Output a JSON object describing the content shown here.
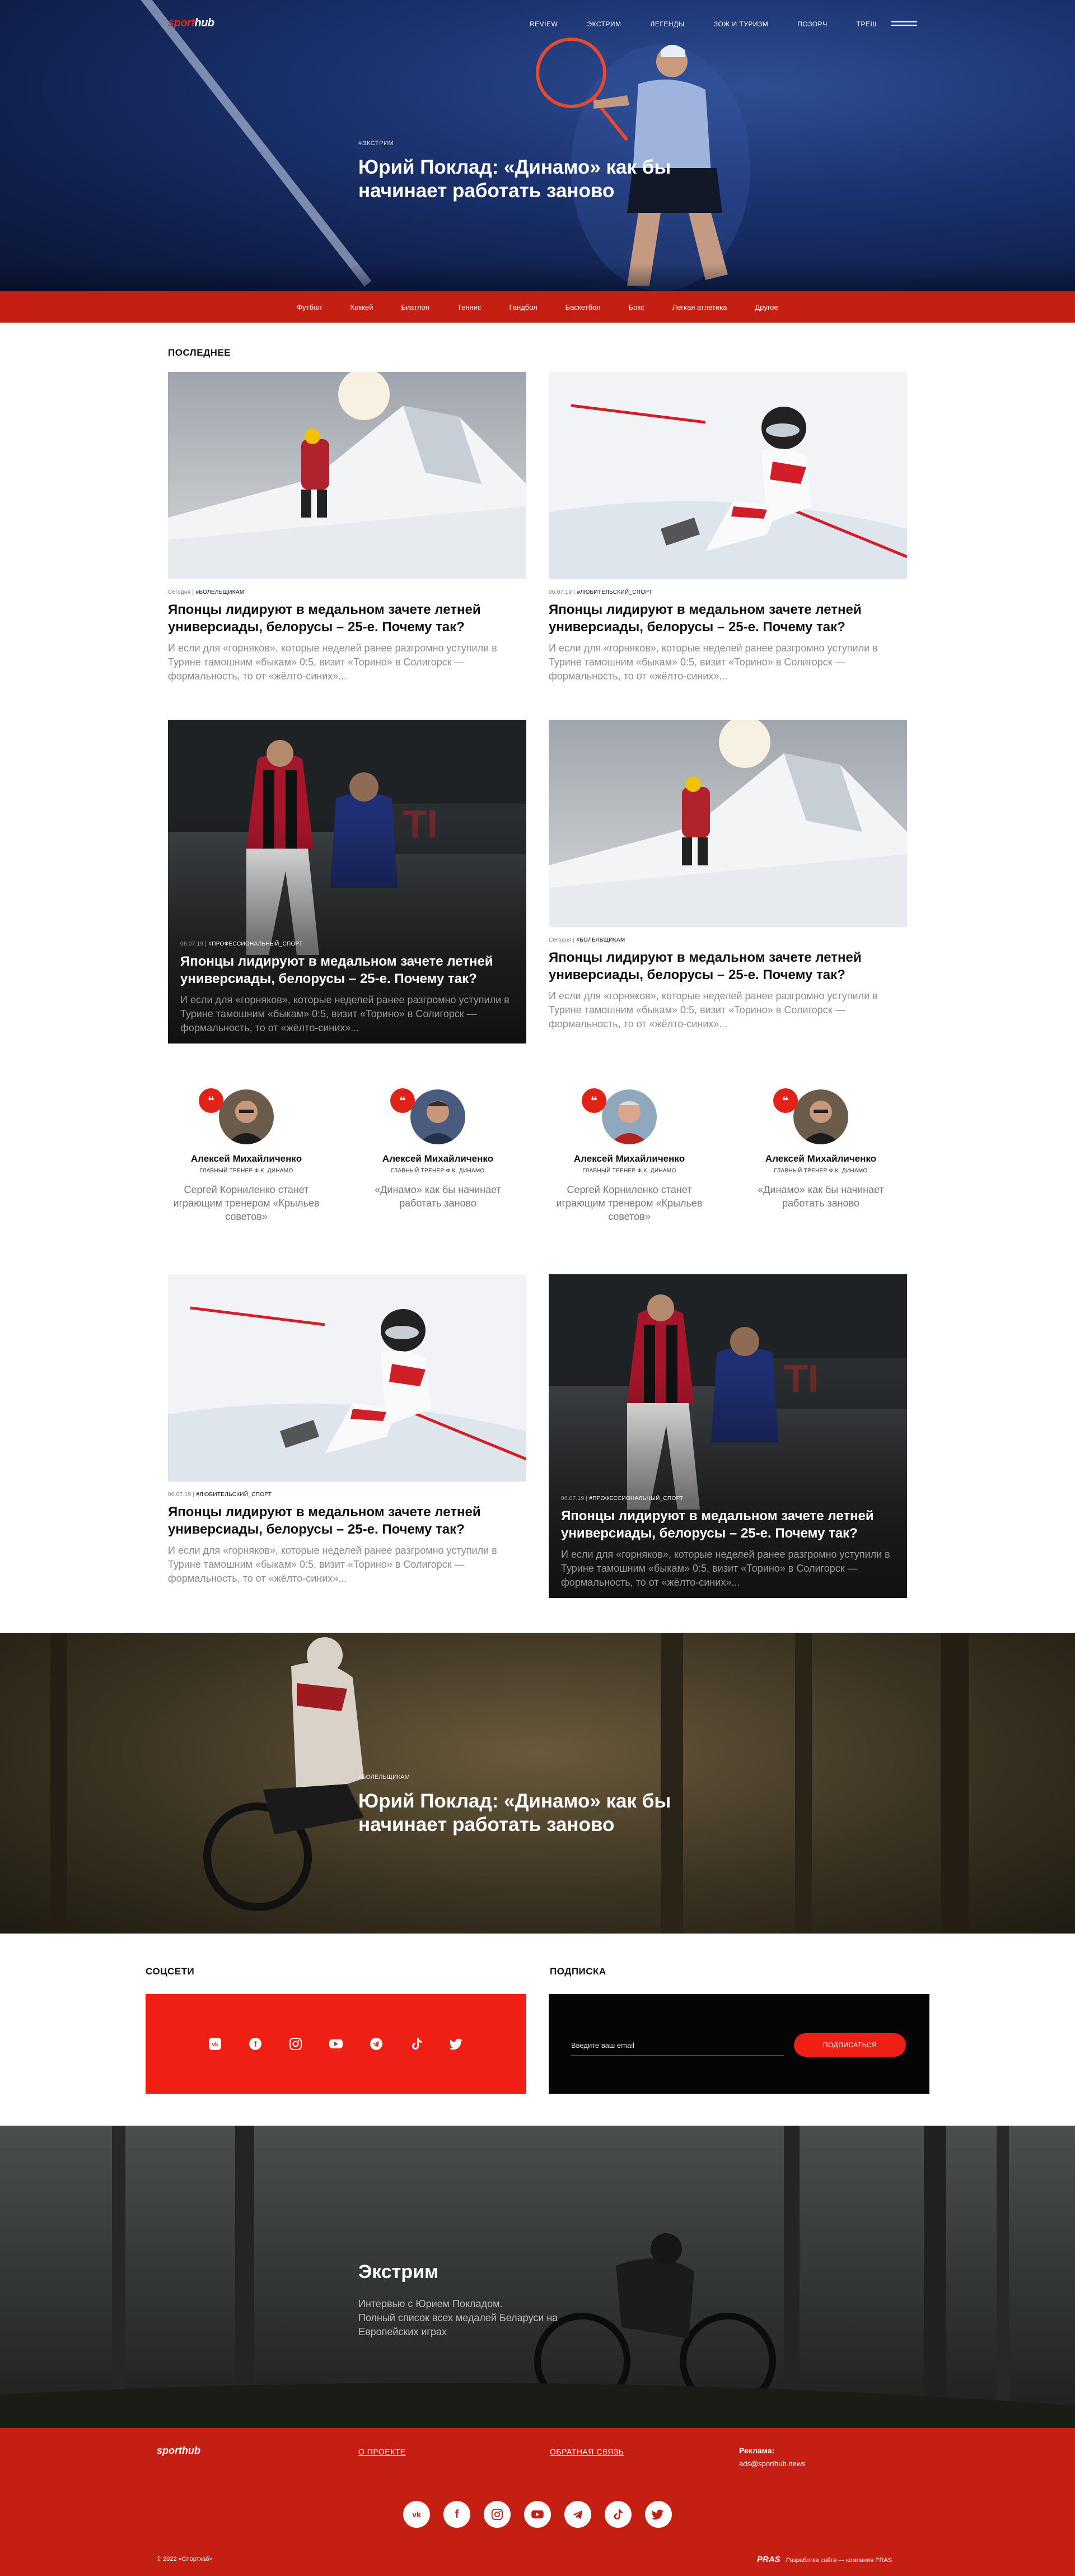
{
  "header": {
    "logo_prefix": "sport",
    "logo_suffix": "hub",
    "nav": [
      "REVIEW",
      "ЭКСТРИМ",
      "ЛЕГЕНДЫ",
      "ЗОЖ И ТУРИЗМ",
      "ПОЗОРЧ",
      "ТРЕШ"
    ]
  },
  "hero": {
    "tag": "#ЭКСТРИМ",
    "title": "Юрий Поклад: «Динамо» как бы начинает работать заново"
  },
  "categories": [
    "Футбол",
    "Хоккей",
    "Биатлон",
    "Теннис",
    "Гандбол",
    "Баскетбол",
    "Бокс",
    "Легкая атлетика",
    "Другое"
  ],
  "latest": {
    "label": "ПОСЛЕДНЕЕ",
    "cards": [
      {
        "date": "Сегодня",
        "tag": "#БОЛЕЛЬЩИКАМ",
        "title": "Японцы лидируют в медальном зачете летней универсиады, белорусы – 25-е. Почему так?",
        "desc": "И если для «горняков», которые неделей ранее разгромно уступили в Турине тамошним «быкам» 0:5, визит «Торино» в Солигорск — формальность, то от «жёлто-синих»..."
      },
      {
        "date": "06.07.19",
        "tag": "#ЛЮБИТЕЛЬСКИЙ_СПОРТ",
        "title": "Японцы лидируют в медальном зачете летней универсиады, белорусы – 25-е. Почему так?",
        "desc": "И если для «горняков», которые неделей ранее разгромно уступили в Турине тамошним «быкам» 0:5, визит «Торино» в Солигорск — формальность, то от «жёлто-синих»..."
      },
      {
        "date": "06.07.19",
        "tag": "#ПРОФЕССИОНАЛЬНЫЙ_СПОРТ",
        "title": "Японцы лидируют в медальном зачете летней универсиады, белорусы – 25-е. Почему так?",
        "desc": "И если для «горняков», которые неделей ранее разгромно уступили в Турине тамошним «быкам» 0:5, визит «Торино» в Солигорск — формальность, то от «жёлто-синих»..."
      },
      {
        "date": "Сегодня",
        "tag": "#БОЛЕЛЬЩИКАМ",
        "title": "Японцы лидируют в медальном зачете летней универсиады, белорусы – 25-е. Почему так?",
        "desc": "И если для «горняков», которые неделей ранее разгромно уступили в Турине тамошним «быкам» 0:5, визит «Торино» в Солигорск — формальность, то от «жёлто-синих»..."
      },
      {
        "date": "06.07.19",
        "tag": "#ЛЮБИТЕЛЬСКИЙ_СПОРТ",
        "title": "Японцы лидируют в медальном зачете летней универсиады, белорусы – 25-е. Почему так?",
        "desc": "И если для «горняков», которые неделей ранее разгромно уступили в Турине тамошним «быкам» 0:5, визит «Торино» в Солигорск — формальность, то от «жёлто-синих»..."
      },
      {
        "date": "06.07.19",
        "tag": "#ПРОФЕССИОНАЛЬНЫЙ_СПОРТ",
        "title": "Японцы лидируют в медальном зачете летней универсиады, белорусы – 25-е. Почему так?",
        "desc": "И если для «горняков», которые неделей ранее разгромно уступили в Турине тамошним «быкам» 0:5, визит «Торино» в Солигорск — формальность, то от «жёлто-синих»..."
      }
    ]
  },
  "quotes": [
    {
      "name": "Алексей Михайличенко",
      "role": "ГЛАВНЫЙ ТРЕНЕР Ф.К. ДИНАМО",
      "text": "Сергей Корниленко станет играющим тренером «Крыльев советов»"
    },
    {
      "name": "Алексей Михайличенко",
      "role": "ГЛАВНЫЙ ТРЕНЕР Ф.К. ДИНАМО",
      "text": "«Динамо» как бы начинает работать заново"
    },
    {
      "name": "Алексей Михайличенко",
      "role": "ГЛАВНЫЙ ТРЕНЕР Ф.К. ДИНАМО",
      "text": "Сергей Корниленко станет играющим тренером «Крыльев советов»"
    },
    {
      "name": "Алексей Михайличенко",
      "role": "ГЛАВНЫЙ ТРЕНЕР Ф.К. ДИНАМО",
      "text": "«Динамо» как бы начинает работать заново"
    }
  ],
  "feature": {
    "tag": "#БОЛЕЛЬЩИКАМ",
    "title": "Юрий Поклад: «Динамо» как бы начинает работать заново"
  },
  "social": {
    "label": "СОЦСЕТИ",
    "icons": [
      "vk-icon",
      "facebook-icon",
      "instagram-icon",
      "youtube-icon",
      "telegram-icon",
      "tiktok-icon",
      "twitter-icon"
    ]
  },
  "subscribe": {
    "label": "ПОДПИСКА",
    "placeholder": "Введите ваш email",
    "button": "ПОДПИСАТЬСЯ"
  },
  "extreme": {
    "title": "Экстрим",
    "lines": [
      "Интервью с Юрием Покладом.",
      "Полный список всех медалей Беларуси на",
      "Европейских играх"
    ]
  },
  "footer": {
    "logo": "sporthub",
    "about": "О ПРОЕКТЕ",
    "feedback": "ОБРАТНАЯ СВЯЗЬ",
    "ad_label": "Реклама:",
    "ad_email": "ads@sporthub.news",
    "copyright": "© 2022 «Спортхаб»",
    "dev_logo": "PRAS",
    "dev_text": "Разработка сайта — компания PRAS"
  },
  "colors": {
    "accent": "#c51f14",
    "bright_red": "#ef1f16",
    "hero_blue": "#1c3472"
  }
}
